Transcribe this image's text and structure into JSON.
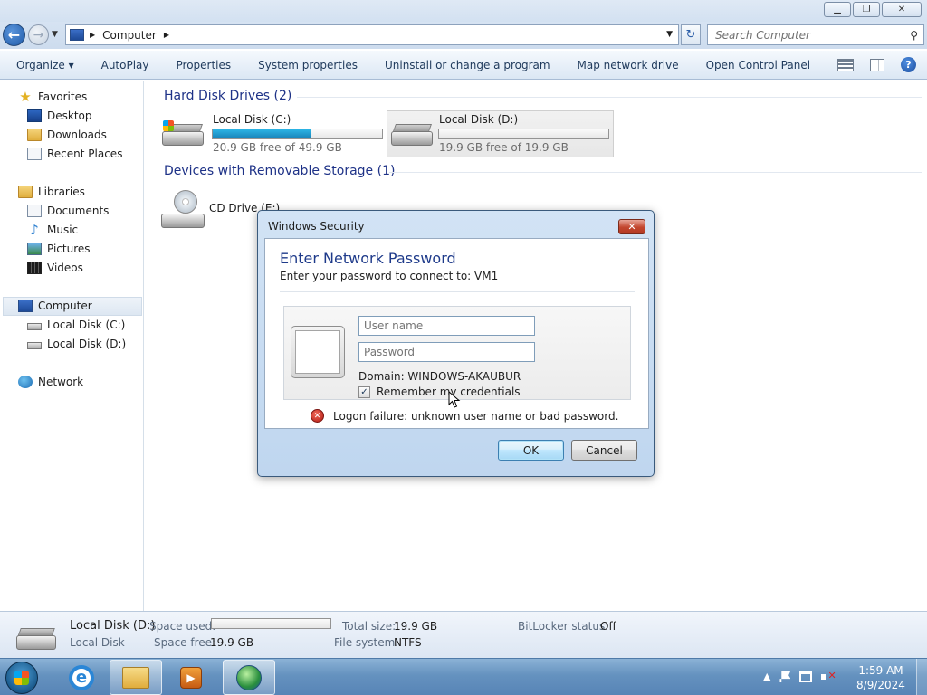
{
  "window": {
    "minimize_icon": "minimize-icon",
    "maximize_icon": "restore-icon",
    "close_icon": "close-icon"
  },
  "address_bar": {
    "crumb": "Computer",
    "search_placeholder": "Search Computer"
  },
  "command_bar": {
    "items": [
      "Organize ▾",
      "AutoPlay",
      "Properties",
      "System properties",
      "Uninstall or change a program",
      "Map network drive",
      "Open Control Panel"
    ]
  },
  "nav_pane": {
    "favorites": "Favorites",
    "desktop": "Desktop",
    "downloads": "Downloads",
    "recent_places": "Recent Places",
    "libraries": "Libraries",
    "documents": "Documents",
    "music": "Music",
    "pictures": "Pictures",
    "videos": "Videos",
    "computer": "Computer",
    "local_c": "Local Disk (C:)",
    "local_d": "Local Disk (D:)",
    "network": "Network"
  },
  "content": {
    "hdd_header": "Hard Disk Drives (2)",
    "removable_header": "Devices with Removable Storage (1)",
    "drives": [
      {
        "name": "Local Disk (C:)",
        "free_text": "20.9 GB free of 49.9 GB",
        "used_fraction": 0.58
      },
      {
        "name": "Local Disk (D:)",
        "free_text": "19.9 GB free of 19.9 GB",
        "used_fraction": 0.0
      }
    ],
    "cd_drive": "CD Drive (E:)"
  },
  "details": {
    "name": "Local Disk (D:)",
    "type": "Local Disk",
    "space_used_label": "Space used:",
    "space_used_fraction": 0.0,
    "space_free_label": "Space free:",
    "space_free_value": "19.9 GB",
    "total_size_label": "Total size:",
    "total_size_value": "19.9 GB",
    "file_system_label": "File system:",
    "file_system_value": "NTFS",
    "bitlocker_label": "BitLocker status:",
    "bitlocker_value": "Off"
  },
  "dialog": {
    "title": "Windows Security",
    "heading": "Enter Network Password",
    "subtitle": "Enter your password to connect to: VM1",
    "username_placeholder": "User name",
    "password_placeholder": "Password",
    "domain": "Domain: WINDOWS-AKAUBUR",
    "remember_label": "Remember my credentials",
    "remember_checked": true,
    "error": "Logon failure: unknown user name or bad password.",
    "ok": "OK",
    "cancel": "Cancel"
  },
  "taskbar": {
    "time": "1:59 AM",
    "date": "8/9/2024"
  }
}
